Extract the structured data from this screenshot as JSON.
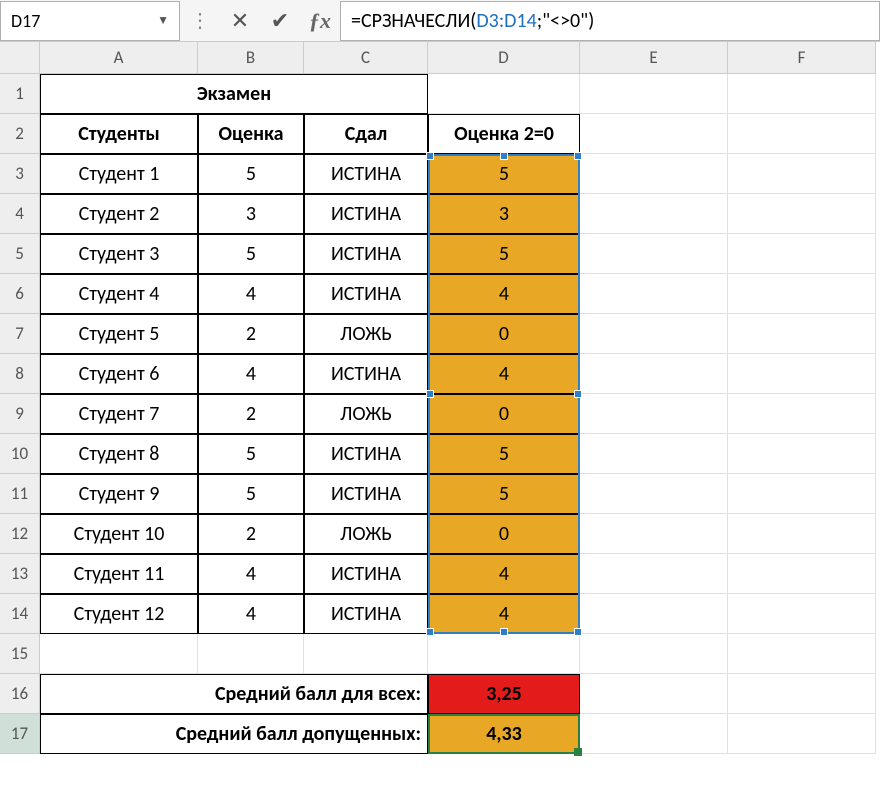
{
  "name_box": "D17",
  "formula": {
    "prefix": "=СРЗНАЧЕСЛИ(",
    "ref": "D3:D14",
    "suffix": ";\"<>0\")"
  },
  "columns": [
    "A",
    "B",
    "C",
    "D",
    "E",
    "F"
  ],
  "rows": [
    "1",
    "2",
    "3",
    "4",
    "5",
    "6",
    "7",
    "8",
    "9",
    "10",
    "11",
    "12",
    "13",
    "14",
    "15",
    "16",
    "17"
  ],
  "title": "Экзамен",
  "headers": {
    "A": "Студенты",
    "B": "Оценка",
    "C": "Сдал",
    "D": "Оценка 2=0"
  },
  "data_rows": [
    {
      "a": "Студент 1",
      "b": "5",
      "c": "ИСТИНА",
      "d": "5"
    },
    {
      "a": "Студент 2",
      "b": "3",
      "c": "ИСТИНА",
      "d": "3"
    },
    {
      "a": "Студент 3",
      "b": "5",
      "c": "ИСТИНА",
      "d": "5"
    },
    {
      "a": "Студент 4",
      "b": "4",
      "c": "ИСТИНА",
      "d": "4"
    },
    {
      "a": "Студент 5",
      "b": "2",
      "c": "ЛОЖЬ",
      "d": "0"
    },
    {
      "a": "Студент 6",
      "b": "4",
      "c": "ИСТИНА",
      "d": "4"
    },
    {
      "a": "Студент 7",
      "b": "2",
      "c": "ЛОЖЬ",
      "d": "0"
    },
    {
      "a": "Студент 8",
      "b": "5",
      "c": "ИСТИНА",
      "d": "5"
    },
    {
      "a": "Студент 9",
      "b": "5",
      "c": "ИСТИНА",
      "d": "5"
    },
    {
      "a": "Студент 10",
      "b": "2",
      "c": "ЛОЖЬ",
      "d": "0"
    },
    {
      "a": "Студент 11",
      "b": "4",
      "c": "ИСТИНА",
      "d": "4"
    },
    {
      "a": "Студент 12",
      "b": "4",
      "c": "ИСТИНА",
      "d": "4"
    }
  ],
  "summary": {
    "label_all": "Средний балл для всех:",
    "value_all": "3,25",
    "label_passed": "Средний балл допущенных:",
    "value_passed": "4,33"
  }
}
